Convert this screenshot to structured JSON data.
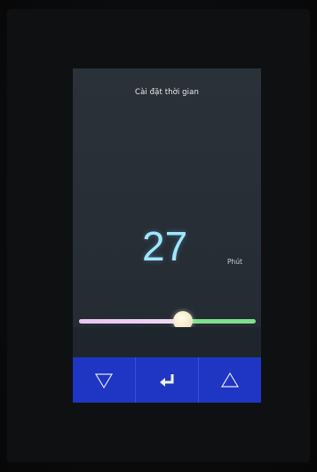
{
  "screen": {
    "title": "Cài đặt thời gian",
    "value": "27",
    "unit": "Phút"
  },
  "slider": {
    "fraction": 0.59,
    "fill_color": "#efcff1",
    "track_color": "#7ee08a",
    "thumb_color": "#f7efd4"
  },
  "buttons": [
    {
      "name": "decrease-button",
      "icon": "triangle-down-icon"
    },
    {
      "name": "enter-button",
      "icon": "enter-arrow-icon"
    },
    {
      "name": "increase-button",
      "icon": "triangle-up-icon"
    }
  ],
  "colors": {
    "button_bar": "#1f35c4",
    "value_text": "#9fe6ff",
    "screen_background": "#262d35"
  }
}
